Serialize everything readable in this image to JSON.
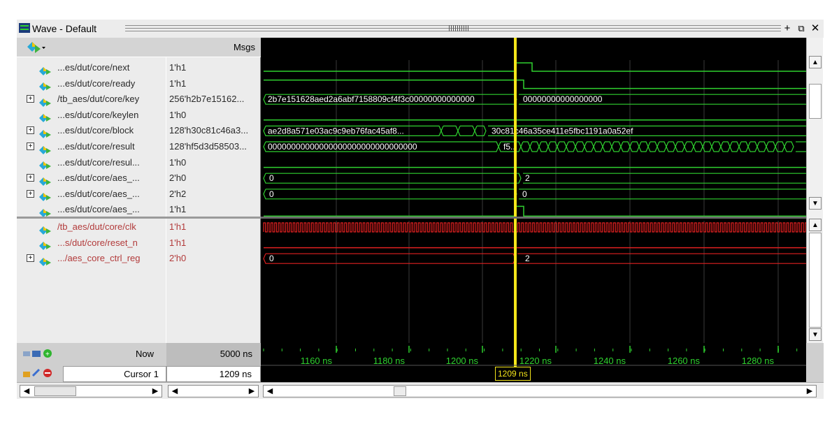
{
  "window": {
    "title": "Wave - Default",
    "buttons": [
      "+",
      "⧉",
      "✕"
    ]
  },
  "header": {
    "msgs_label": "Msgs"
  },
  "signals_top": [
    {
      "name": "...es/dut/core/next",
      "value": "1'h1",
      "expandable": false
    },
    {
      "name": "...es/dut/core/ready",
      "value": "1'h1",
      "expandable": false
    },
    {
      "name": "/tb_aes/dut/core/key",
      "value": "256'h2b7e15162...",
      "expandable": true
    },
    {
      "name": "...es/dut/core/keylen",
      "value": "1'h0",
      "expandable": false
    },
    {
      "name": "...es/dut/core/block",
      "value": "128'h30c81c46a3...",
      "expandable": true
    },
    {
      "name": "...es/dut/core/result",
      "value": "128'hf5d3d58503...",
      "expandable": true
    },
    {
      "name": "...es/dut/core/resul...",
      "value": "1'h0",
      "expandable": false
    },
    {
      "name": "...es/dut/core/aes_...",
      "value": "2'h0",
      "expandable": true
    },
    {
      "name": "...es/dut/core/aes_...",
      "value": "2'h2",
      "expandable": true
    },
    {
      "name": "...es/dut/core/aes_...",
      "value": "1'h1",
      "expandable": false
    }
  ],
  "signals_bottom": [
    {
      "name": "/tb_aes/dut/core/clk",
      "value": "1'h1",
      "expandable": false
    },
    {
      "name": "...s/dut/core/reset_n",
      "value": "1'h1",
      "expandable": false
    },
    {
      "name": ".../aes_core_ctrl_reg",
      "value": "2'h0",
      "expandable": true
    }
  ],
  "wave_labels": {
    "key_before": "2b7e151628aed2a6abf7158809cf4f3c00000000000000",
    "key_after": "00000000000000000",
    "block_before": "ae2d8a571e03ac9c9eb76fac45af8...",
    "block_after": "30c81c46a35ce411e5fbc1191a0a52ef",
    "result_before": "00000000000000000000000000000000",
    "result_after": "f5...",
    "aes_a_before": "0",
    "aes_a_after": "2",
    "aes_b_before": "0",
    "aes_b_after": "0",
    "ctrl_before": "0",
    "ctrl_after": "2"
  },
  "status": {
    "now_label": "Now",
    "now_value": "5000 ns",
    "cursor_label": "Cursor 1",
    "cursor_value": "1209 ns",
    "cursor_marker": "1209 ns"
  },
  "time_axis": {
    "ticks": [
      "1160 ns",
      "1180 ns",
      "1200 ns",
      "1220 ns",
      "1240 ns",
      "1260 ns",
      "1280 ns"
    ]
  },
  "colors": {
    "wave_green": "#2fd12f",
    "wave_red": "#e02020",
    "cursor_yellow": "#f5e61a",
    "axis_text": "#2fd12f"
  }
}
